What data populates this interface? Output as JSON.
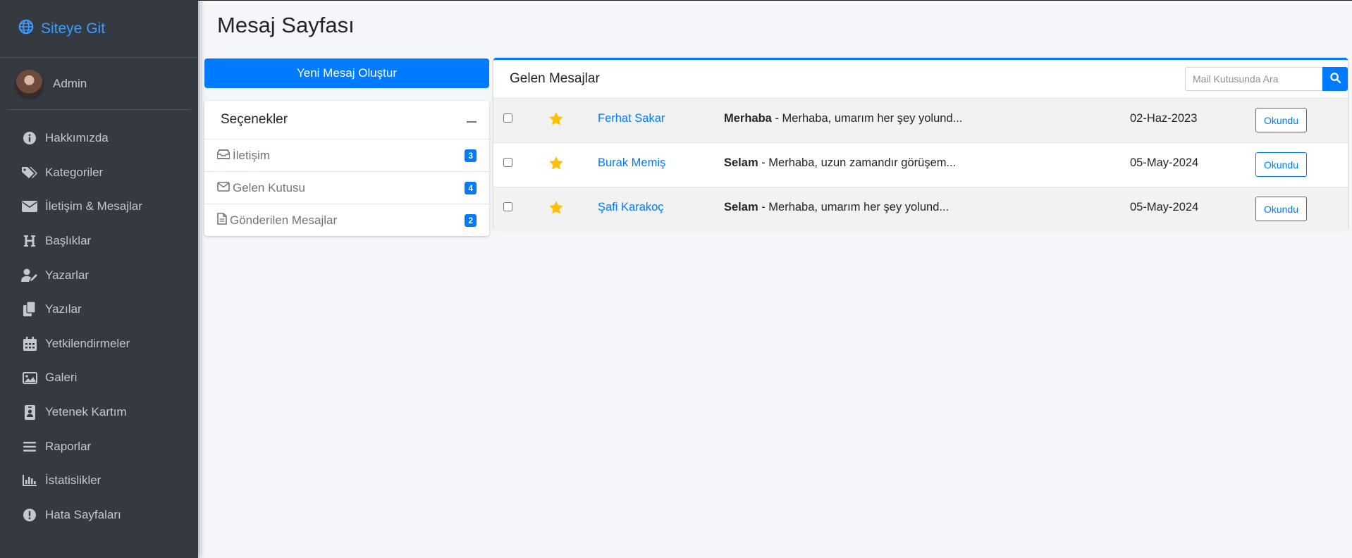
{
  "sidebar": {
    "brand": "Siteye Git",
    "user": "Admin",
    "items": [
      {
        "label": "Hakkımızda",
        "icon": "info-circle-icon"
      },
      {
        "label": "Kategoriler",
        "icon": "tags-icon"
      },
      {
        "label": "İletişim & Mesajlar",
        "icon": "envelope-icon"
      },
      {
        "label": "Başlıklar",
        "icon": "heading-icon"
      },
      {
        "label": "Yazarlar",
        "icon": "user-edit-icon"
      },
      {
        "label": "Yazılar",
        "icon": "copy-icon"
      },
      {
        "label": "Yetkilendirmeler",
        "icon": "calendar-icon"
      },
      {
        "label": "Galeri",
        "icon": "image-icon"
      },
      {
        "label": "Yetenek Kartım",
        "icon": "id-badge-icon"
      },
      {
        "label": "Raporlar",
        "icon": "bars-icon"
      },
      {
        "label": "İstatislikler",
        "icon": "chart-bar-icon"
      },
      {
        "label": "Hata Sayfaları",
        "icon": "exclamation-circle-icon"
      }
    ]
  },
  "main": {
    "title": "Mesaj Sayfası",
    "new_message_button": "Yeni Mesaj Oluştur",
    "options": {
      "title": "Seçenekler",
      "items": [
        {
          "label": "İletişim",
          "count": "3",
          "icon": "inbox-icon"
        },
        {
          "label": "Gelen Kutusu",
          "count": "4",
          "icon": "envelope-outline-icon"
        },
        {
          "label": "Gönderilen Mesajlar",
          "count": "2",
          "icon": "file-icon"
        }
      ]
    },
    "inbox": {
      "title": "Gelen Mesajlar",
      "search_placeholder": "Mail Kutusunda Ara",
      "messages": [
        {
          "sender": "Ferhat Sakar",
          "subject": "Merhaba",
          "preview": " - Merhaba, umarım her şey yolund...",
          "date": "02-Haz-2023",
          "action": "Okundu"
        },
        {
          "sender": "Burak Memiş",
          "subject": "Selam",
          "preview": " - Merhaba, uzun zamandır görüşem...",
          "date": "05-May-2024",
          "action": "Okundu"
        },
        {
          "sender": "Şafi Karakoç",
          "subject": "Selam",
          "preview": " - Merhaba, umarım her şey yolund...",
          "date": "05-May-2024",
          "action": "Okundu"
        }
      ]
    }
  },
  "colors": {
    "primary": "#007bff",
    "sidebar_bg": "#343a40",
    "star": "#ffc107"
  }
}
